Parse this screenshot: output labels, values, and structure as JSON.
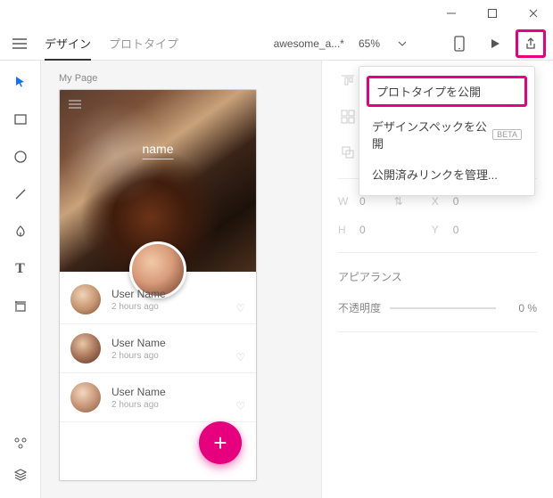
{
  "window": {
    "minimize": "－",
    "maximize": "☐",
    "close": "✕"
  },
  "topbar": {
    "tabs": {
      "design": "デザイン",
      "prototype": "プロトタイプ"
    },
    "filename": "awesome_a...*",
    "zoom": "65%"
  },
  "share_menu": {
    "publish_prototype": "プロトタイプを公開",
    "publish_spec": "デザインスペックを公開",
    "spec_badge": "BETA",
    "manage_links": "公開済みリンクを管理..."
  },
  "canvas": {
    "artboard_name": "My Page",
    "hero_name": "name",
    "rows": [
      {
        "name": "User Name",
        "time": "2 hours ago"
      },
      {
        "name": "User Name",
        "time": "2 hours ago"
      },
      {
        "name": "User Name",
        "time": "2 hours ago"
      }
    ],
    "fab": "+"
  },
  "panel": {
    "w_label": "W",
    "w_val": "0",
    "h_label": "H",
    "h_val": "0",
    "x_label": "X",
    "x_val": "0",
    "y_label": "Y",
    "y_val": "0",
    "appearance": "アピアランス",
    "opacity_label": "不透明度",
    "opacity_val": "0 %"
  }
}
